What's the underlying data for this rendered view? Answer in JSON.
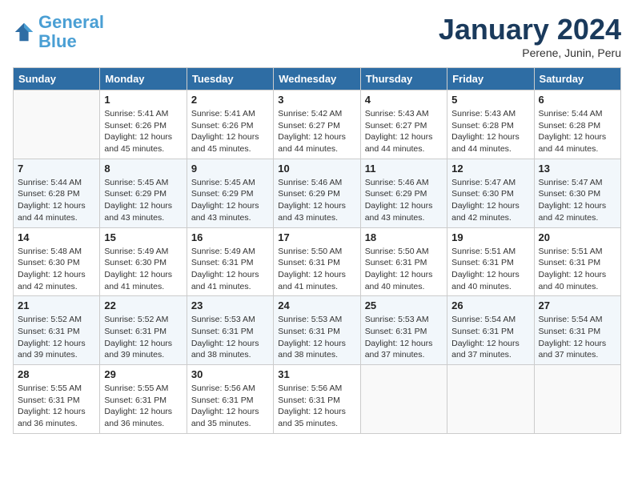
{
  "header": {
    "logo_line1": "General",
    "logo_line2": "Blue",
    "month": "January 2024",
    "location": "Perene, Junin, Peru"
  },
  "columns": [
    "Sunday",
    "Monday",
    "Tuesday",
    "Wednesday",
    "Thursday",
    "Friday",
    "Saturday"
  ],
  "weeks": [
    [
      {
        "day": "",
        "info": ""
      },
      {
        "day": "1",
        "info": "Sunrise: 5:41 AM\nSunset: 6:26 PM\nDaylight: 12 hours\nand 45 minutes."
      },
      {
        "day": "2",
        "info": "Sunrise: 5:41 AM\nSunset: 6:26 PM\nDaylight: 12 hours\nand 45 minutes."
      },
      {
        "day": "3",
        "info": "Sunrise: 5:42 AM\nSunset: 6:27 PM\nDaylight: 12 hours\nand 44 minutes."
      },
      {
        "day": "4",
        "info": "Sunrise: 5:43 AM\nSunset: 6:27 PM\nDaylight: 12 hours\nand 44 minutes."
      },
      {
        "day": "5",
        "info": "Sunrise: 5:43 AM\nSunset: 6:28 PM\nDaylight: 12 hours\nand 44 minutes."
      },
      {
        "day": "6",
        "info": "Sunrise: 5:44 AM\nSunset: 6:28 PM\nDaylight: 12 hours\nand 44 minutes."
      }
    ],
    [
      {
        "day": "7",
        "info": "Sunrise: 5:44 AM\nSunset: 6:28 PM\nDaylight: 12 hours\nand 44 minutes."
      },
      {
        "day": "8",
        "info": "Sunrise: 5:45 AM\nSunset: 6:29 PM\nDaylight: 12 hours\nand 43 minutes."
      },
      {
        "day": "9",
        "info": "Sunrise: 5:45 AM\nSunset: 6:29 PM\nDaylight: 12 hours\nand 43 minutes."
      },
      {
        "day": "10",
        "info": "Sunrise: 5:46 AM\nSunset: 6:29 PM\nDaylight: 12 hours\nand 43 minutes."
      },
      {
        "day": "11",
        "info": "Sunrise: 5:46 AM\nSunset: 6:29 PM\nDaylight: 12 hours\nand 43 minutes."
      },
      {
        "day": "12",
        "info": "Sunrise: 5:47 AM\nSunset: 6:30 PM\nDaylight: 12 hours\nand 42 minutes."
      },
      {
        "day": "13",
        "info": "Sunrise: 5:47 AM\nSunset: 6:30 PM\nDaylight: 12 hours\nand 42 minutes."
      }
    ],
    [
      {
        "day": "14",
        "info": "Sunrise: 5:48 AM\nSunset: 6:30 PM\nDaylight: 12 hours\nand 42 minutes."
      },
      {
        "day": "15",
        "info": "Sunrise: 5:49 AM\nSunset: 6:30 PM\nDaylight: 12 hours\nand 41 minutes."
      },
      {
        "day": "16",
        "info": "Sunrise: 5:49 AM\nSunset: 6:31 PM\nDaylight: 12 hours\nand 41 minutes."
      },
      {
        "day": "17",
        "info": "Sunrise: 5:50 AM\nSunset: 6:31 PM\nDaylight: 12 hours\nand 41 minutes."
      },
      {
        "day": "18",
        "info": "Sunrise: 5:50 AM\nSunset: 6:31 PM\nDaylight: 12 hours\nand 40 minutes."
      },
      {
        "day": "19",
        "info": "Sunrise: 5:51 AM\nSunset: 6:31 PM\nDaylight: 12 hours\nand 40 minutes."
      },
      {
        "day": "20",
        "info": "Sunrise: 5:51 AM\nSunset: 6:31 PM\nDaylight: 12 hours\nand 40 minutes."
      }
    ],
    [
      {
        "day": "21",
        "info": "Sunrise: 5:52 AM\nSunset: 6:31 PM\nDaylight: 12 hours\nand 39 minutes."
      },
      {
        "day": "22",
        "info": "Sunrise: 5:52 AM\nSunset: 6:31 PM\nDaylight: 12 hours\nand 39 minutes."
      },
      {
        "day": "23",
        "info": "Sunrise: 5:53 AM\nSunset: 6:31 PM\nDaylight: 12 hours\nand 38 minutes."
      },
      {
        "day": "24",
        "info": "Sunrise: 5:53 AM\nSunset: 6:31 PM\nDaylight: 12 hours\nand 38 minutes."
      },
      {
        "day": "25",
        "info": "Sunrise: 5:53 AM\nSunset: 6:31 PM\nDaylight: 12 hours\nand 37 minutes."
      },
      {
        "day": "26",
        "info": "Sunrise: 5:54 AM\nSunset: 6:31 PM\nDaylight: 12 hours\nand 37 minutes."
      },
      {
        "day": "27",
        "info": "Sunrise: 5:54 AM\nSunset: 6:31 PM\nDaylight: 12 hours\nand 37 minutes."
      }
    ],
    [
      {
        "day": "28",
        "info": "Sunrise: 5:55 AM\nSunset: 6:31 PM\nDaylight: 12 hours\nand 36 minutes."
      },
      {
        "day": "29",
        "info": "Sunrise: 5:55 AM\nSunset: 6:31 PM\nDaylight: 12 hours\nand 36 minutes."
      },
      {
        "day": "30",
        "info": "Sunrise: 5:56 AM\nSunset: 6:31 PM\nDaylight: 12 hours\nand 35 minutes."
      },
      {
        "day": "31",
        "info": "Sunrise: 5:56 AM\nSunset: 6:31 PM\nDaylight: 12 hours\nand 35 minutes."
      },
      {
        "day": "",
        "info": ""
      },
      {
        "day": "",
        "info": ""
      },
      {
        "day": "",
        "info": ""
      }
    ]
  ]
}
